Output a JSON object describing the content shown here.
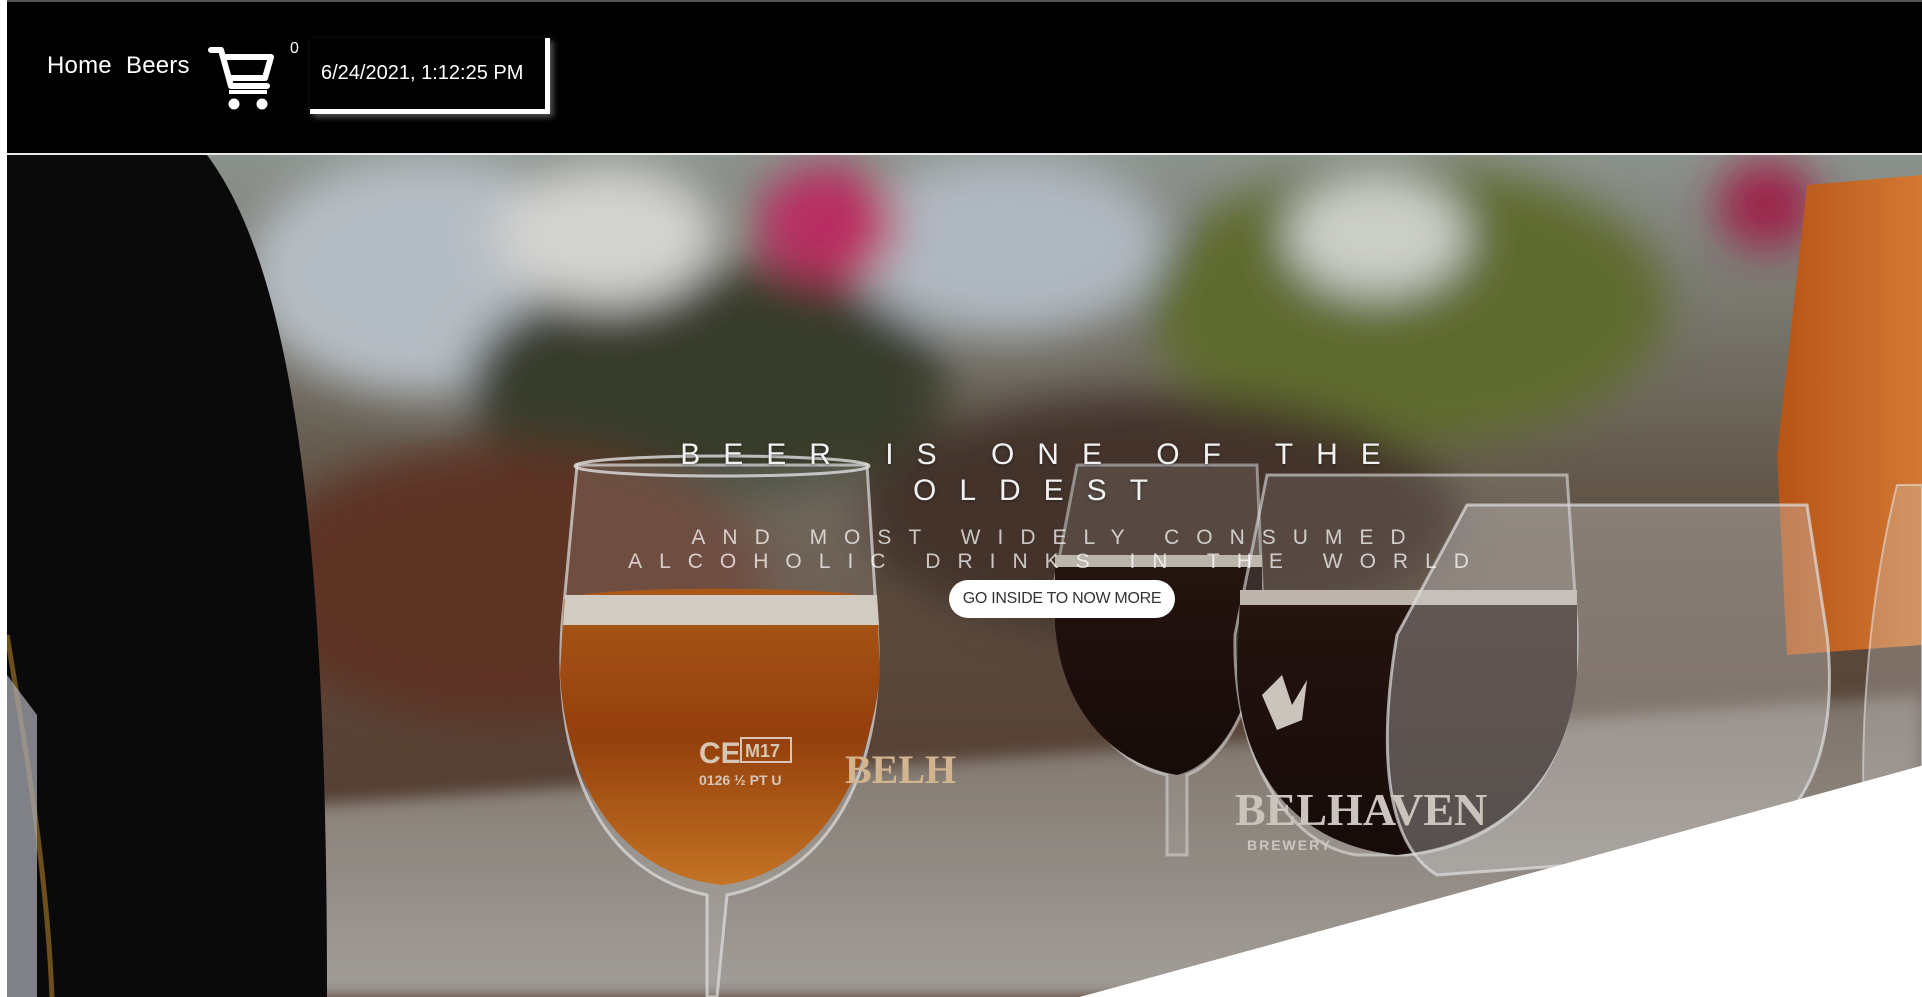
{
  "nav": {
    "links": [
      "Home",
      "Beers"
    ],
    "cart_count": "0",
    "datetime": "6/24/2021, 1:12:25 PM"
  },
  "hero": {
    "title": "BEER IS ONE OF THE OLDEST",
    "subtitle": "AND MOST WIDELY CONSUMED ALCOHOLIC DRINKS IN THE WORLD",
    "button_label": "GO INSIDE TO NOW MORE",
    "glass_labels": {
      "ce_mark": "CE",
      "m17": "M17",
      "volume": "0126 ½ PT U",
      "brand_short": "BELH",
      "brand": "BELHAVEN",
      "sub": "BREWERY"
    }
  }
}
